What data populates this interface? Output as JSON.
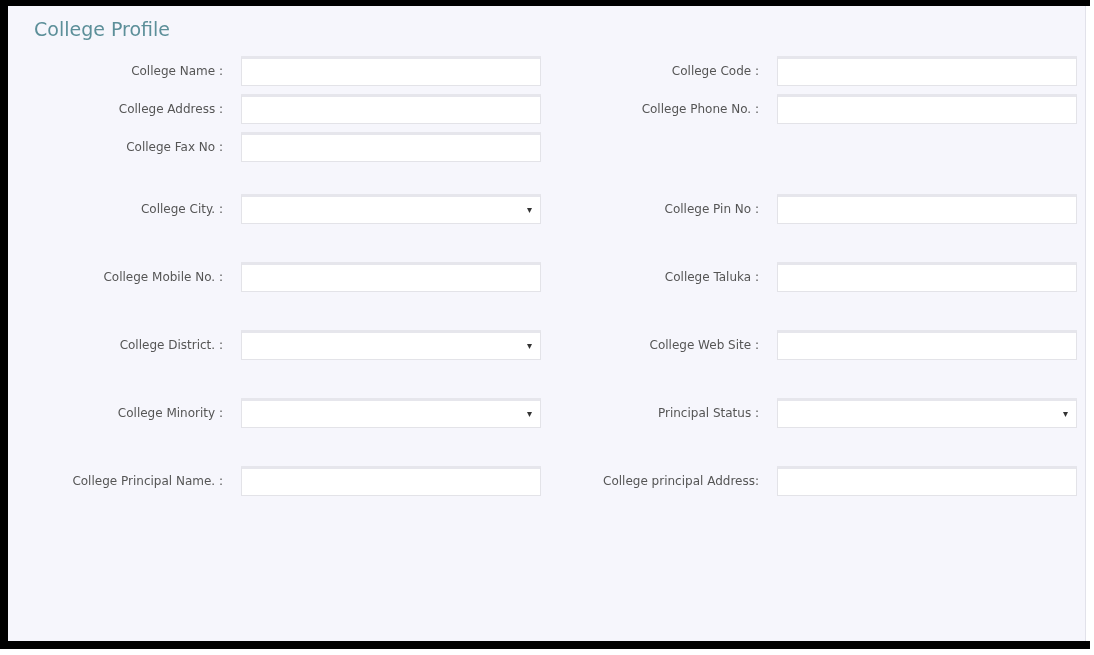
{
  "title": "College Profile",
  "sections": [
    {
      "rows": [
        {
          "left": {
            "label": "College Name :",
            "kind": "text"
          },
          "right": {
            "label": "College Code :",
            "kind": "text"
          }
        },
        {
          "left": {
            "label": "College Address :",
            "kind": "text"
          },
          "right": {
            "label": "College Phone No. :",
            "kind": "text"
          }
        },
        {
          "left": {
            "label": "College Fax No :",
            "kind": "text"
          }
        }
      ]
    },
    {
      "rows": [
        {
          "left": {
            "label": "College City. :",
            "kind": "select"
          },
          "right": {
            "label": "College Pin No :",
            "kind": "text"
          }
        },
        {
          "left": {
            "label": "College Mobile No. :",
            "kind": "text"
          },
          "right": {
            "label": "College Taluka :",
            "kind": "text"
          }
        },
        {
          "left": {
            "label": "College District. :",
            "kind": "select"
          },
          "right": {
            "label": "College Web Site :",
            "kind": "text"
          }
        },
        {
          "left": {
            "label": "College Minority :",
            "kind": "select"
          },
          "right": {
            "label": "Principal Status :",
            "kind": "select"
          }
        },
        {
          "left": {
            "label": "College Principal Name. :",
            "kind": "text"
          },
          "right": {
            "label": "College principal Address:",
            "kind": "text"
          }
        }
      ]
    }
  ]
}
